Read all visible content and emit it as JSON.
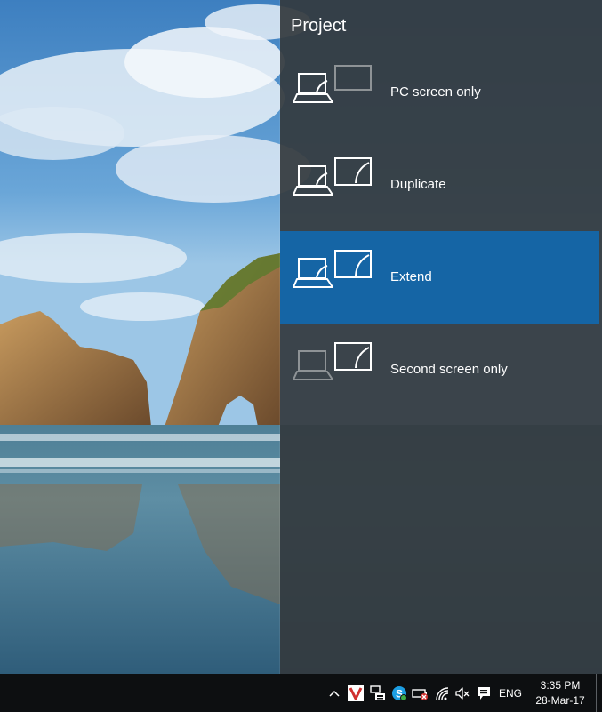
{
  "panel": {
    "title": "Project",
    "options": [
      {
        "label": "PC screen only",
        "icon": "pc-screen-only-icon",
        "selected": false
      },
      {
        "label": "Duplicate",
        "icon": "duplicate-icon",
        "selected": false
      },
      {
        "label": "Extend",
        "icon": "extend-icon",
        "selected": true
      },
      {
        "label": "Second screen only",
        "icon": "second-screen-only-icon",
        "selected": false
      }
    ]
  },
  "taskbar": {
    "language": "ENG",
    "time": "3:35 PM",
    "date": "28-Mar-17",
    "tray_icons": [
      "chevron-up-icon",
      "antivirus-icon",
      "network-adapter-icon",
      "skype-icon",
      "battery-warning-icon",
      "wifi-icon",
      "speaker-muted-icon",
      "action-center-icon"
    ]
  },
  "colors": {
    "panel_background": "#343a3e",
    "selected_option": "#1565a5",
    "taskbar": "#0d0f11",
    "text": "#ffffff",
    "antivirus_red": "#d0302f",
    "skype_blue": "#1c9ee3"
  }
}
